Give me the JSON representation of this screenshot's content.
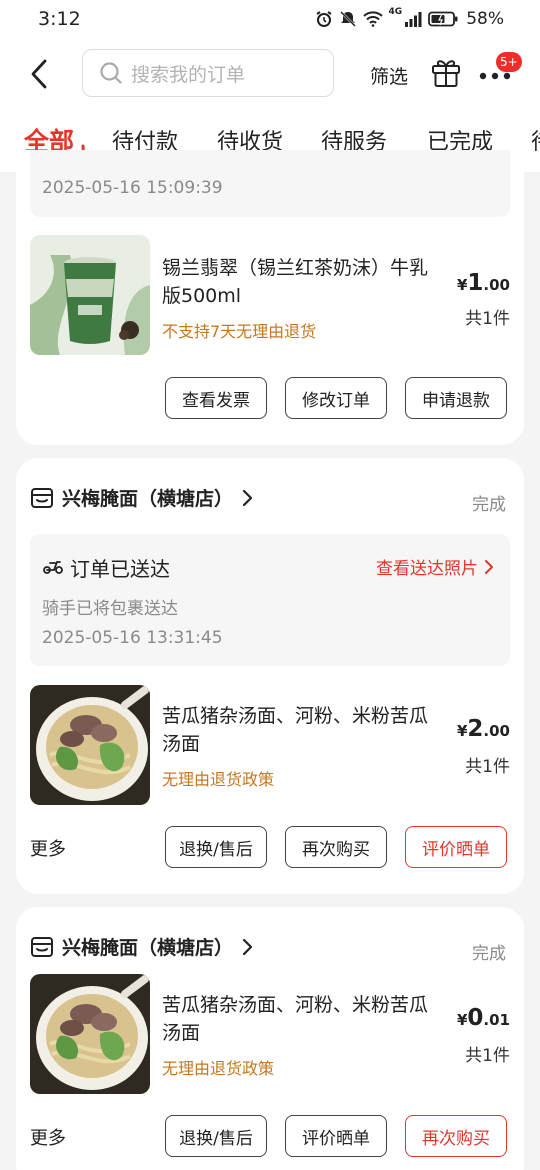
{
  "status_bar": {
    "time": "3:12",
    "network": "4G",
    "battery": "58%"
  },
  "header": {
    "search_placeholder": "搜索我的订单",
    "filter_label": "筛选",
    "more_badge": "5+"
  },
  "tabs": [
    "全部",
    "待付款",
    "待收货",
    "待服务",
    "已完成",
    "待"
  ],
  "orders": [
    {
      "delivery_time": "2025-05-16 15:09:39",
      "product": {
        "title": "锡兰翡翠（锡兰红茶奶沫）牛乳版500ml",
        "note": "不支持7天无理由退货",
        "price_currency": "¥",
        "price_int": "1",
        "price_dec": ".00",
        "qty": "共1件"
      },
      "buttons": [
        "查看发票",
        "修改订单",
        "申请退款"
      ]
    },
    {
      "store": "兴梅腌面（横塘店）",
      "status": "完成",
      "delivery_title": "订单已送达",
      "delivery_link": "查看送达照片",
      "delivery_sub": "骑手已将包裹送达",
      "delivery_time": "2025-05-16 13:31:45",
      "product": {
        "title": "苦瓜猪杂汤面、河粉、米粉苦瓜汤面",
        "note": "无理由退货政策",
        "price_currency": "¥",
        "price_int": "2",
        "price_dec": ".00",
        "qty": "共1件"
      },
      "more": "更多",
      "buttons": [
        "退换/售后",
        "再次购买",
        "评价晒单"
      ]
    },
    {
      "store": "兴梅腌面（横塘店）",
      "status": "完成",
      "product": {
        "title": "苦瓜猪杂汤面、河粉、米粉苦瓜汤面",
        "note": "无理由退货政策",
        "price_currency": "¥",
        "price_int": "0",
        "price_dec": ".01",
        "qty": "共1件"
      },
      "more": "更多",
      "buttons": [
        "退换/售后",
        "评价晒单",
        "再次购买"
      ]
    }
  ],
  "colors": {
    "accent": "#e4362b",
    "note": "#c6781e",
    "muted": "#8a8a8a"
  }
}
